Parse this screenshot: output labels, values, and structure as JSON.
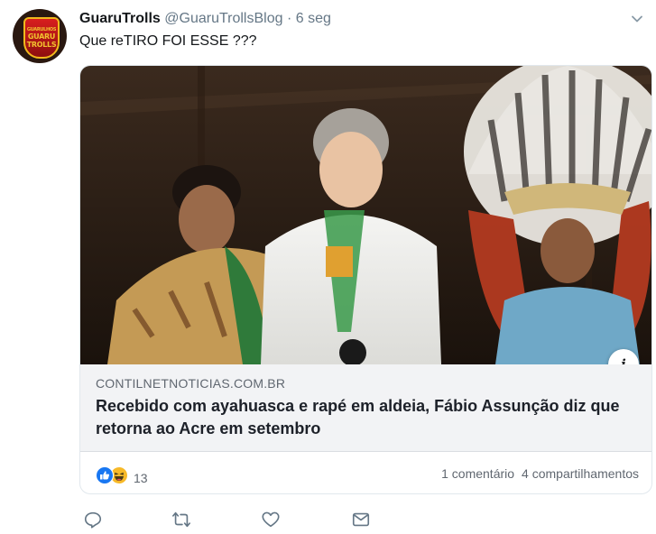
{
  "tweet": {
    "author_name": "GuaruTrolls",
    "handle": "@GuaruTrollsBlog",
    "separator": "·",
    "time": "6 seg",
    "text": "Que reTIRO FOI ESSE ???"
  },
  "avatar": {
    "line1": "GUARULHOS",
    "line2": "GUARU",
    "line3": "TROLLS"
  },
  "card": {
    "domain": "CONTILNETNOTICIAS.COM.BR",
    "headline": "Recebido com ayahuasca e rapé em aldeia, Fábio Assunção diz que retorna ao Acre em setembro",
    "info_label": "i",
    "reaction_count": "13",
    "comments": "1 comentário",
    "shares": "4 compartilhamentos"
  },
  "icons": {
    "reply": "reply-icon",
    "retweet": "retweet-icon",
    "like": "heart-icon",
    "dm": "mail-icon",
    "caret": "chevron-down-icon"
  },
  "colors": {
    "icon_gray": "#657786",
    "like_blue": "#1877f2",
    "haha_yellow": "#f7b928",
    "card_meta_bg": "#f2f3f5"
  }
}
